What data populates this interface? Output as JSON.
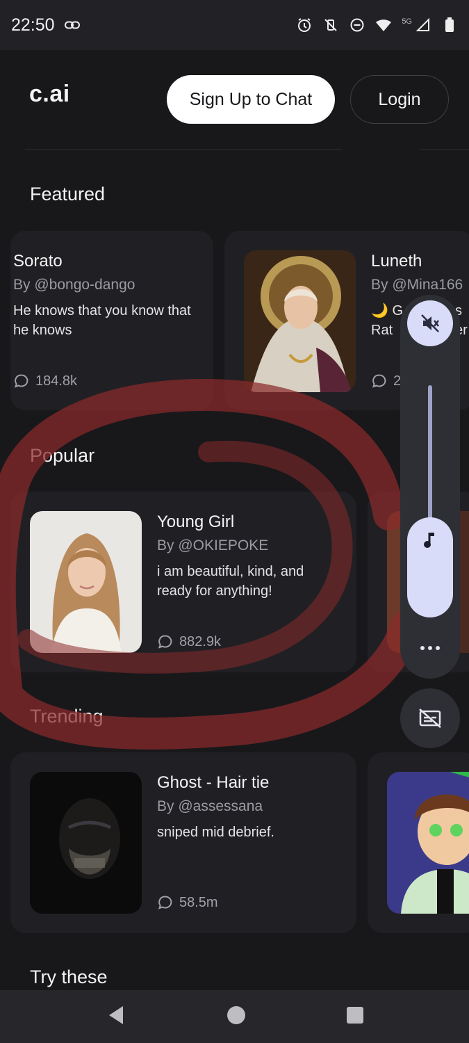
{
  "status_bar": {
    "time": "22:50",
    "network": "5G",
    "icons": [
      "link-icon",
      "alarm-icon",
      "vibrate-off-icon",
      "dnd-icon",
      "wifi-icon",
      "signal-icon",
      "battery-icon"
    ]
  },
  "header": {
    "logo": "c.ai",
    "signup_label": "Sign Up to Chat",
    "login_label": "Login"
  },
  "sections": {
    "featured": "Featured",
    "popular": "Popular",
    "trending": "Trending",
    "try_these": "Try these"
  },
  "featured_cards": [
    {
      "name": "Sorato",
      "author": "By @bongo-dango",
      "description": "He knows that you know that he knows",
      "count": "184.8k"
    },
    {
      "name": "Luneth",
      "author": "By @Mina166",
      "description": "🌙 G",
      "description_2": "s",
      "description_3": "Rat",
      "description_4": "er",
      "count": "2"
    }
  ],
  "popular_cards": [
    {
      "name": "Young Girl",
      "author": "By @OKIEPOKE",
      "description": "i am beautiful, kind, and ready for anything!",
      "count": "882.9k"
    }
  ],
  "trending_cards": [
    {
      "name": "Ghost - Hair tie",
      "author": "By @assessana",
      "description": "sniped mid debrief.",
      "count": "58.5m"
    }
  ],
  "volume_panel": {
    "level": 0.35,
    "muted": true,
    "icons": [
      "volume-off-icon",
      "music-note-icon",
      "more-icon",
      "captions-off-icon"
    ]
  },
  "colors": {
    "background": "#18181b",
    "card": "#202024",
    "annotation": "#8b2a2a",
    "volume_accent": "#d8dcf8"
  }
}
